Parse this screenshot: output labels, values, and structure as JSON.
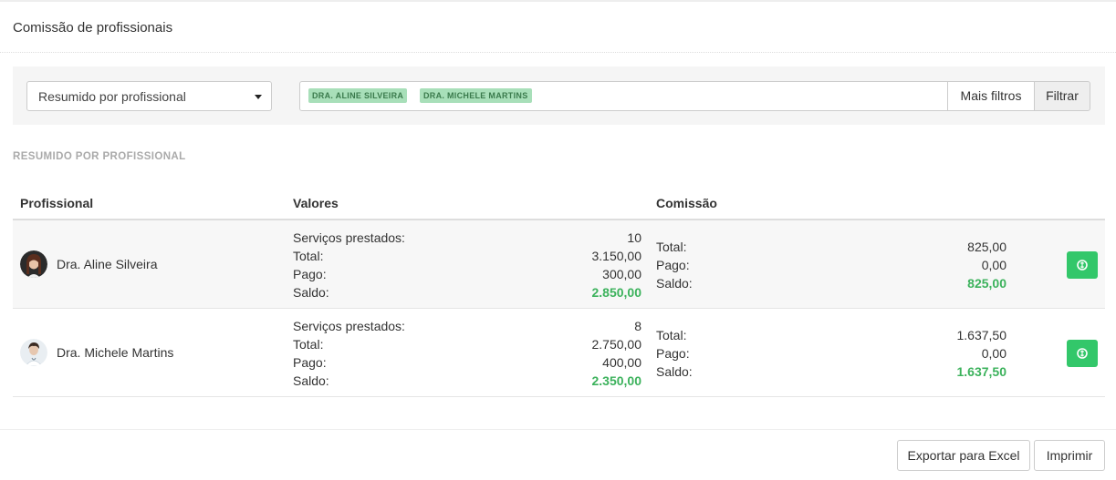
{
  "page": {
    "title": "Comissão de profissionais"
  },
  "filters": {
    "view_select": {
      "selected": "Resumido por profissional"
    },
    "tags": [
      "DRA. ALINE SILVEIRA",
      "DRA. MICHELE MARTINS"
    ],
    "more_filters_label": "Mais filtros",
    "filter_label": "Filtrar"
  },
  "section": {
    "label": "RESUMIDO POR PROFISSIONAL"
  },
  "table": {
    "headers": {
      "profissional": "Profissional",
      "valores": "Valores",
      "comissao": "Comissão"
    },
    "labels": {
      "servicos": "Serviços prestados:",
      "total": "Total:",
      "pago": "Pago:",
      "saldo": "Saldo:"
    },
    "rows": [
      {
        "name": "Dra. Aline Silveira",
        "avatar_icon": "female-professional-avatar",
        "valores": {
          "servicos": "10",
          "total": "3.150,00",
          "pago": "300,00",
          "saldo": "2.850,00"
        },
        "comissao": {
          "total": "825,00",
          "pago": "0,00",
          "saldo": "825,00"
        },
        "action_icon": "money-icon"
      },
      {
        "name": "Dra. Michele Martins",
        "avatar_icon": "female-professional-avatar",
        "valores": {
          "servicos": "8",
          "total": "2.750,00",
          "pago": "400,00",
          "saldo": "2.350,00"
        },
        "comissao": {
          "total": "1.637,50",
          "pago": "0,00",
          "saldo": "1.637,50"
        },
        "action_icon": "money-icon"
      }
    ]
  },
  "footer": {
    "export_label": "Exportar para Excel",
    "print_label": "Imprimir"
  },
  "colors": {
    "accent_green": "#33c76a",
    "saldo_green": "#3cb25c",
    "tag_bg": "#a8dfb9"
  }
}
